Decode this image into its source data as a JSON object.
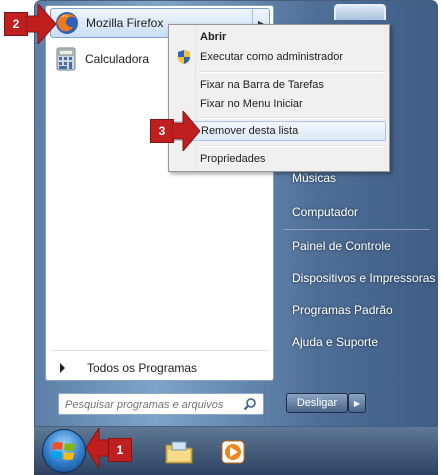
{
  "start_menu": {
    "pinned": [
      {
        "label": "Mozilla Firefox",
        "icon": "firefox-icon"
      },
      {
        "label": "Calculadora",
        "icon": "calculator-icon"
      }
    ],
    "all_programs": "Todos os Programas",
    "search_placeholder": "Pesquisar programas e arquivos",
    "right_items": [
      "Músicas",
      "Computador",
      "Painel de Controle",
      "Dispositivos e Impressoras",
      "Programas Padrão",
      "Ajuda e Suporte"
    ],
    "shutdown_label": "Desligar"
  },
  "context_menu": {
    "items": [
      "Abrir",
      "Executar como administrador",
      "Fixar na Barra de Tarefas",
      "Fixar no Menu Iniciar",
      "Remover desta lista",
      "Propriedades"
    ]
  },
  "badges": [
    "1",
    "2",
    "3"
  ],
  "colors": {
    "badge": "#c01f1f",
    "highlight": "#c9def5",
    "menu_bg": "#f0f0f0"
  }
}
